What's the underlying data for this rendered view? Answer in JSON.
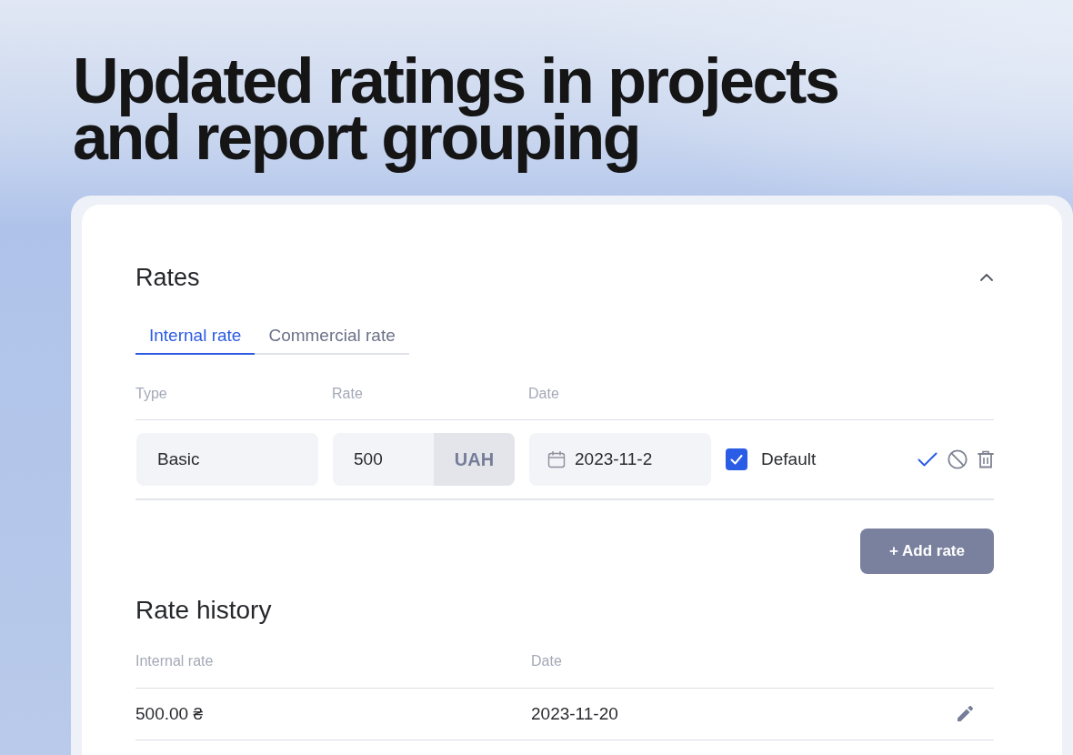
{
  "headline": "Updated ratings in projects and report grouping",
  "rates": {
    "title": "Rates",
    "expanded": true,
    "tabs": [
      {
        "label": "Internal rate",
        "selected": true
      },
      {
        "label": "Commercial rate",
        "selected": false
      }
    ],
    "columns": [
      "Type",
      "Rate",
      "Date"
    ],
    "rows": [
      {
        "type": "Basic",
        "rate": "500",
        "currency": "UAH",
        "date": "2023-11-2",
        "default": true,
        "default_label": "Default"
      }
    ],
    "add_button": "+ Add rate"
  },
  "history": {
    "title": "Rate history",
    "columns": [
      "Internal rate",
      "Date"
    ],
    "rows": [
      {
        "rate": "500.00 ₴",
        "date": "2023-11-20"
      }
    ]
  }
}
